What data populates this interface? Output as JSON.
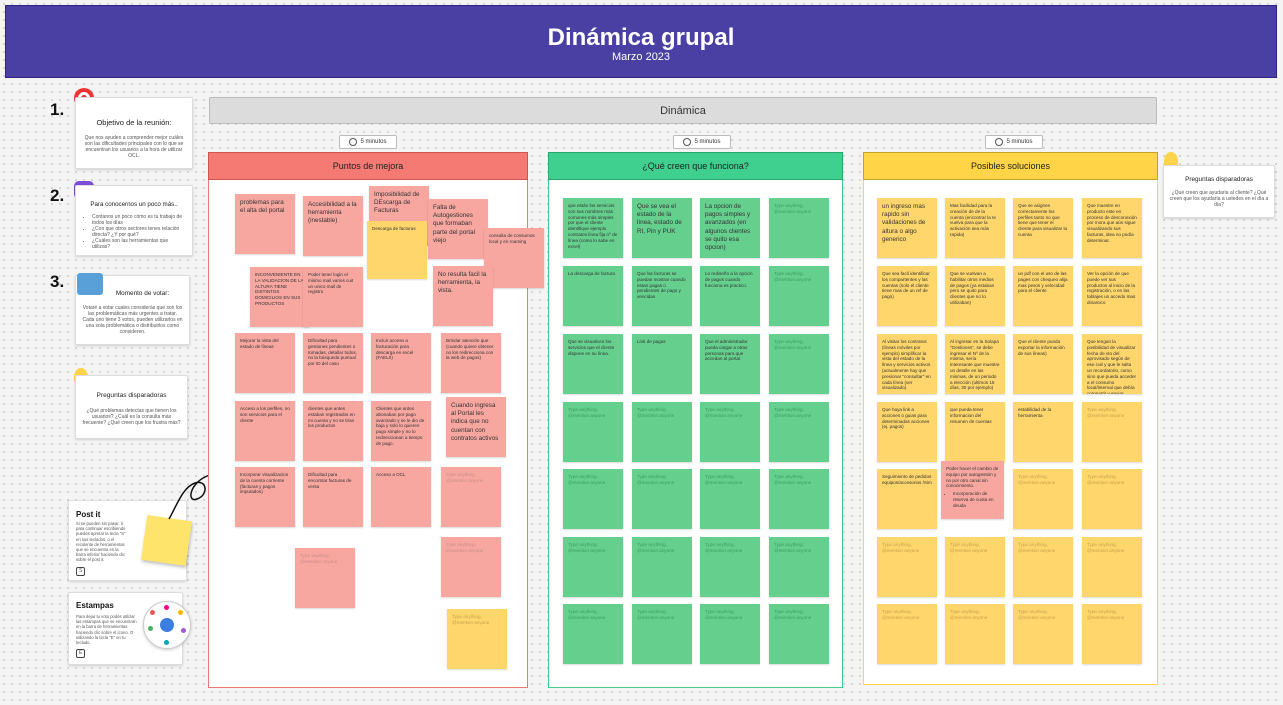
{
  "header": {
    "title": "Dinámica grupal",
    "subtitle": "Marzo 2023"
  },
  "steps": {
    "s1": {
      "number": "1.",
      "title": "Objetivo de la reunión:",
      "body": "Que nos ayuden a comprender mejor cuáles son las dificultades principales con lo que se encuentran los usuarios a la hora de utilizar OCL."
    },
    "s2": {
      "number": "2.",
      "title": "Para conocernos un poco más..",
      "items": [
        "Contanos un poco cómo es tu trabajo de todos los días",
        "¿Con que otros sectores tenes relación directa? ¿Y por qué?",
        "¿Cuáles son las herramientas que utilizas?"
      ]
    },
    "s3": {
      "number": "3.",
      "title": "Momento de votar:",
      "body": "Votaré a votar cuales considerás que son los las problemáticas más urgentes a tratar. Cada uno tiene 3 votos, pueden utilizarlos en una sola problemática o distribuirlos como consideren."
    },
    "s4": {
      "title": "Preguntas disparadoras",
      "body": "¿Qué problemas detectas que tienen los usuarios? ¿Cuál es la consulta más frecuente? ¿Qué creen que los frustra más?"
    }
  },
  "postit": {
    "title": "Post it",
    "body": "Si se pueden sin pasar, ti para continuar escribiendo puedes apretar la tecla \"S\" en sus teclados, o el recolente de herramientas que se encuentra en la barra inferior haciendo clic sobre el post it.",
    "key": "S"
  },
  "estampas": {
    "title": "Estampas",
    "body": "Para dejar tu voto podés utilizar las estampas que se encuentran en la barra de herramientas haciendo clic sobre el ícono. O utilizando la tecla \"E\" en tu teclado.",
    "key": "E"
  },
  "dinamica": {
    "label": "Dinámica",
    "timer": "5 minutos"
  },
  "columns": {
    "mejora": {
      "title": "Puntos de mejora",
      "color": "#f47a73"
    },
    "funciona": {
      "title": "¿Qué creen que funciona?",
      "color": "#3fd08f"
    },
    "soluciones": {
      "title": "Posibles soluciones",
      "color": "#ffd547"
    }
  },
  "preguntas_right": {
    "title": "Preguntas disparadoras",
    "body": "¿Qué creen que ayudaría al cliente? ¿Qué creen que los ayudaría a ustedes en el día a día?"
  },
  "placeholder": "Type anything, @mention anyone",
  "notes": {
    "m1": "problemas para el alta del portal",
    "m2": "Accesibilidad a la herramienta (inestable)",
    "m3": "Imposibilidad de DEscarga de Facturas",
    "m3b": "Descarga de facturas",
    "m4": "Falta de Autogestiones que formaban parte del portal viejo",
    "m5": "consulta de consumos local y en roaming",
    "m6": "INCONVENIENTE EN LA VALIDACION DE LA ALTURA TIENE DISTINTOS DOMICILIOS EN SUS PRODUCTOS",
    "m7": "Poder tener login el mismo mail varios cuit un unico mail de registro",
    "m8": "No resulta facil la herramienta, la vista.",
    "m9": "Mejorar la vista del estado de líneas",
    "m10": "Dificultad para gestiones pendientes o tomadas, detallar todos, no la búsqueda puntual por ID del caso",
    "m11": "Incluir acceso a facturación para descarga en excel (FAEL0)",
    "m12": "Brindar atención que (cuando quiere obtener no los redirecciona con la web de pagos)",
    "m13": "Acceso a los perfiles, no son servicios para el cliente",
    "m14": "clientes que antes estaban registrados en mi cuenta y no se tiran los productos",
    "m15": "Clientes que antes abonaban por pago avanzado y se le dio de baja y solo lo quieren pago simple y no lo redireccionan a tiempo de pago.",
    "m16": "Cuando ingresa al Portal les indica que no cuentan con contratos activos",
    "m17": "Incorporar visualizacion de la cuenta corriente (facturas y pagos imputados)",
    "m18": "Dificultad para encontrar facturas de venta",
    "m19": "Acceso a OCL",
    "f1": "que están los servicios con sus nombres más comunes más simples por que el cliente identifique ejemplo contratos línea fija nº de línea (como lo sabe en excel)",
    "f2": "Que se vea el estado de la línea, estado de RI, Pin y PUK",
    "f3": "La opcion de pagos simples y avanzados (en algunos clientes se quito esa opcion)",
    "f4": "La descarga de factura",
    "f5": "Que las facturas se puedan mostrar cuando estan pagas o pendientes de pago y vencidas",
    "f6": "Lo rediseño a la opcion de pagos cuando funciona es practico.",
    "f7": "Que se visualicen los servicios que el cliente dispone en su línea.",
    "f8": "Link de pagos",
    "f9": "Que el administrador pueda cargar a otras personas para que accedan al portal.",
    "y1": "un ingreso mas rapido sin validaciones de altura o algo generico",
    "y2": "Mas facilidad para la creación de de la cuenta (encontrar la te vuelva para que la activación sea más rapida)",
    "y3": "Que se asignen correctamente los perfiles tanto no que tiene que tener el cliente para visualizar la cuenta",
    "y4": "Que muestre en producto este en proceso de desconexión por mora que aún sigue visualizando sus facturas, idea no podía determinar.",
    "y5": "Que sea facil identificar los compartentes y las cuentas (solo el cliente tiene mas de un ref de pago)",
    "y6": "Que se vuelvan a habilitar otros medios de pagos (ya estaban pero se quito para clientes que no lo utilizaban)",
    "y7": "un pdf con el uso de las pages con chequeo alija mas pesos y velocidad para el cliente",
    "y8": "Ver la opción de que puede ver sus productos al inicio de la registración, o en las tablajes un accedo mas dinamico",
    "y9": "Al visitar los contratos (líneas móviles por ejemplo) simplificar la vista del estado de la línea y servicios activos (actualmente hay que presionar \"consultar\" en cada línea (ver visualizado)",
    "y10": "Al ingresar en la Solapa \"Gestiones\", se debe ingresar el Nº de la misma, sería interesante que muestre un detalle en las mismas, de un periodo a elección (ultimos 15 días, 30 por ejemplo)",
    "y11": "Que el cliente pueda exportar la información de sus líneas)",
    "y12": "Que tengan la posibilidad de visualizar fecha de vto del aprovisado según de ese cuit y que le salta un recordatorio, como sino que pueda acceder a el consumo local/internal que debía compartir y enviar directamente dentro de Ocl",
    "y13": "Que haya link a acciones o guias para determinadas acciones (ej. pagos)",
    "y14": "que pueda tener informacion del resumen de cuentas",
    "y15": "estabilidad de la herramienta",
    "y16": "Seguimiento de pedidos equipos/accesorios /Sim",
    "pk1": "Poder hacer el cambio de equipo por autogestión y no por otro canal sin conocimiento.",
    "pk2": "Incorporación de reserva de cuota en deuda"
  }
}
